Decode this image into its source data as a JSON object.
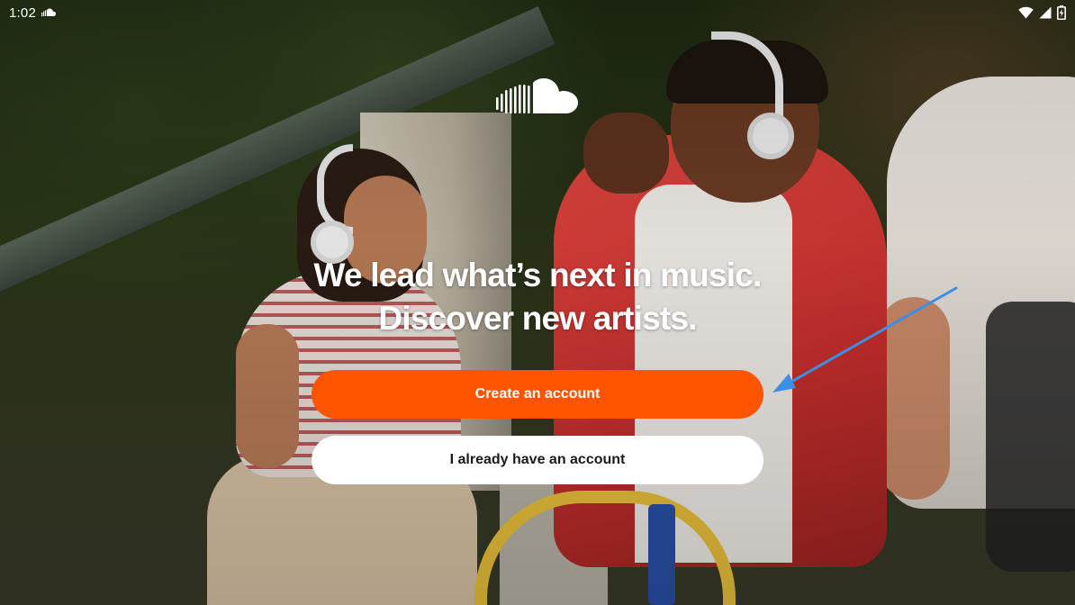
{
  "status_bar": {
    "time": "1:02",
    "icons": [
      "soundcloud-notification-icon",
      "wifi-icon",
      "cellular-signal-icon",
      "battery-icon"
    ]
  },
  "logo": {
    "icon": "soundcloud-logo-icon"
  },
  "headline": {
    "line1": "We lead what’s next in music.",
    "line2": "Discover new artists."
  },
  "buttons": {
    "create_account": "Create an account",
    "sign_in": "I already have an account"
  },
  "colors": {
    "accent": "#ff5500",
    "secondary_button_bg": "#ffffff",
    "annotation_arrow": "#3d8fe6"
  }
}
